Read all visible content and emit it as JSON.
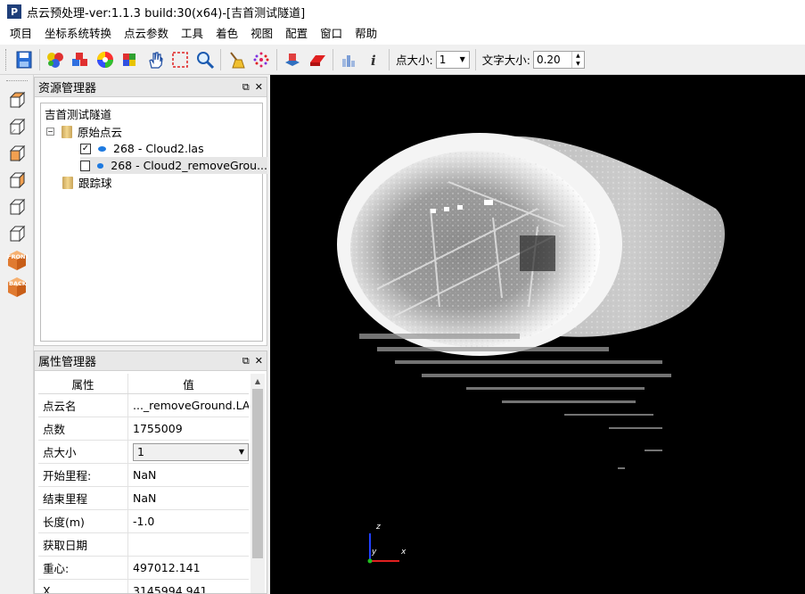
{
  "window": {
    "title": "点云预处理-ver:1.1.3 build:30(x64)-[吉首测试隧道]",
    "icon_letter": "P"
  },
  "menu": [
    "项目",
    "坐标系统转换",
    "点云参数",
    "工具",
    "着色",
    "视图",
    "配置",
    "窗口",
    "帮助"
  ],
  "toolbar": {
    "buttons": [
      "save-icon",
      "color-palette-icon",
      "rgb-cubes-icon",
      "color-wheel-icon",
      "color-scale-icon",
      "pan-hand-icon",
      "select-rect-icon",
      "zoom-magnifier-icon",
      "broom-clean-icon",
      "point-sample-icon",
      "export-icon",
      "segment-icon",
      "statistics-icon",
      "info-icon"
    ],
    "point_size_label": "点大小:",
    "point_size_value": "1",
    "text_size_label": "文字大小:",
    "text_size_value": "0.20"
  },
  "left_toolbar": [
    "view-top-icon",
    "view-bottom-icon",
    "view-left-icon",
    "view-right-icon",
    "view-iso1-icon",
    "view-iso2-icon",
    "view-front-icon",
    "view-back-icon"
  ],
  "left_toolbar_labels": {
    "front": "FRONT",
    "back": "BACK"
  },
  "resource_panel": {
    "title": "资源管理器",
    "root": "吉首测试隧道",
    "folder1": "原始点云",
    "items": [
      {
        "label": "268 - Cloud2.las",
        "checked": true
      },
      {
        "label": "268 - Cloud2_removeGrou...",
        "checked": false
      }
    ],
    "folder2": "跟踪球"
  },
  "property_panel": {
    "title": "属性管理器",
    "col_key": "属性",
    "col_value": "值",
    "rows": [
      {
        "k": "点云名",
        "v": "..._removeGround.LAS"
      },
      {
        "k": "点数",
        "v": "1755009"
      },
      {
        "k": "点大小",
        "v": "1"
      },
      {
        "k": "开始里程:",
        "v": "NaN"
      },
      {
        "k": "结束里程",
        "v": "NaN"
      },
      {
        "k": "长度(m)",
        "v": "-1.0"
      },
      {
        "k": "获取日期",
        "v": ""
      },
      {
        "k": "重心:",
        "v": "497012.141"
      },
      {
        "k": "X",
        "v": "3145994.941"
      }
    ]
  },
  "axes": {
    "z": "z",
    "y": "y",
    "x": "x"
  },
  "colors": {
    "viewport_bg": "#000000",
    "axis_x": "#e02020",
    "axis_y": "#20c020",
    "axis_z": "#2040ff"
  }
}
